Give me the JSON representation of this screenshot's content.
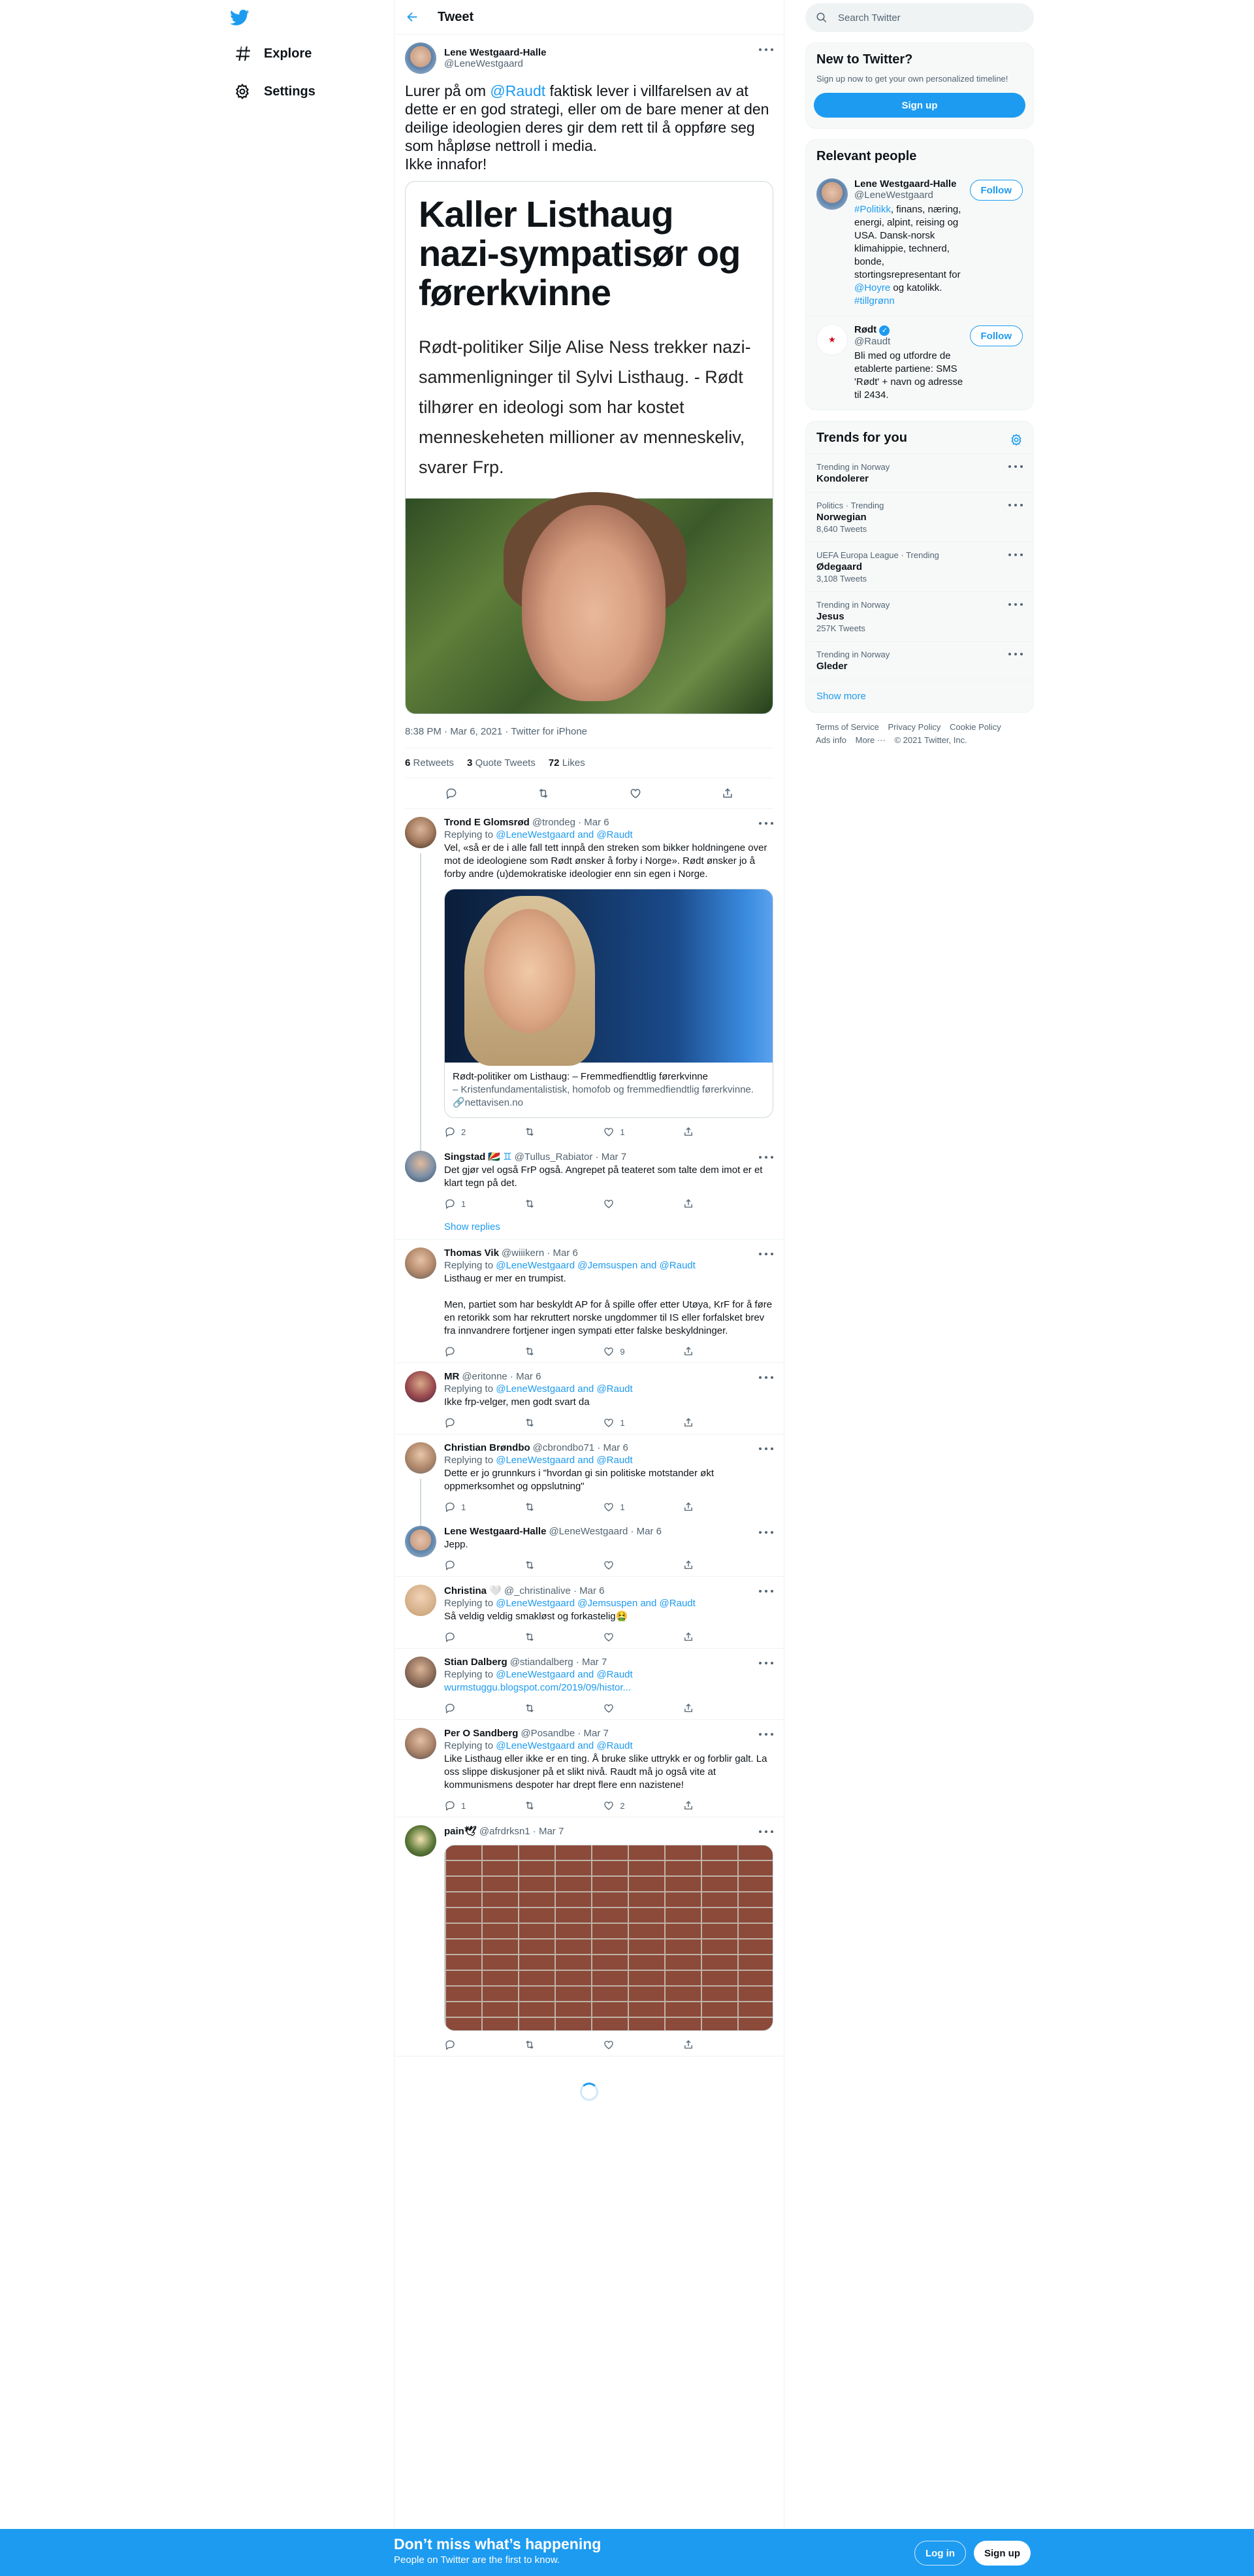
{
  "nav": {
    "explore_label": "Explore",
    "settings_label": "Settings"
  },
  "header": {
    "title": "Tweet"
  },
  "main_tweet": {
    "author_name": "Lene Westgaard-Halle",
    "author_handle": "@LeneWestgaard",
    "text_before": "Lurer på om ",
    "mention": "@Raudt",
    "text_after": " faktisk lever i villfarelsen av at dette er en god strategi, eller om de bare mener at den deilige ideologien deres gir dem rett til å oppføre seg som håpløse nettroll i media.\nIkke innafor!",
    "article_headline": "Kaller Listhaug nazi-sympatisør og førerkvinne",
    "article_lead": "Rødt-politiker Silje Alise Ness trekker nazi-sammenligninger til Sylvi Listhaug. - Rødt tilhører en ideologi som har kostet menneskeheten millioner av menneskeliv, svarer Frp.",
    "meta": "8:38 PM · Mar 6, 2021 · Twitter for iPhone",
    "retweets_count": "6",
    "retweets_label": "Retweets",
    "quotes_count": "3",
    "quotes_label": "Quote Tweets",
    "likes_count": "72",
    "likes_label": "Likes"
  },
  "replies": [
    {
      "name": "Trond E Glomsrød",
      "handle": "@trondeg · Mar 6",
      "replying_prefix": "Replying to ",
      "replying_to": "@LeneWestgaard and @Raudt",
      "text": "Vel, «så er de i alle fall tett innpå den streken som bikker holdningene over mot de ideologiene som Rødt ønsker å forby i Norge». Rødt ønsker jo å forby andre (u)demokratiske ideologier enn sin egen i Norge.",
      "card_title": "Rødt-politiker om Listhaug: – Fremmedfiendtlig førerkvinne",
      "card_sub": "– Kristenfundamentalistisk, homofob og fremmedfiendtlig førerkvinne.",
      "card_domain": "nettavisen.no",
      "replies": "2",
      "retweets": "",
      "likes": "1"
    },
    {
      "name": "Singstad",
      "handle": "@Tullus_Rabiator · Mar 7",
      "text": "Det gjør vel også FrP også. Angrepet på teateret som talte dem imot er et klart tegn på det.",
      "replies": "1",
      "retweets": "",
      "likes": ""
    },
    {
      "name": "Thomas Vik",
      "handle": "@wiiikern · Mar 6",
      "replying_prefix": "Replying to ",
      "replying_to": "@LeneWestgaard @Jemsuspen and @Raudt",
      "text": "Listhaug er mer en trumpist.\n\nMen, partiet som har beskyldt AP for å spille offer etter Utøya, KrF for å føre en retorikk som har rekruttert norske ungdommer til IS eller forfalsket brev fra innvandrere fortjener ingen sympati etter falske beskyldninger.",
      "replies": "",
      "retweets": "",
      "likes": "9"
    },
    {
      "name": "MR",
      "handle": "@eritonne · Mar 6",
      "replying_prefix": "Replying to ",
      "replying_to": "@LeneWestgaard and @Raudt",
      "text": "Ikke frp-velger, men godt svart da",
      "replies": "",
      "retweets": "",
      "likes": "1"
    },
    {
      "name": "Christian Brøndbo",
      "handle": "@cbrondbo71 · Mar 6",
      "replying_prefix": "Replying to ",
      "replying_to": "@LeneWestgaard and @Raudt",
      "text": "Dette er jo grunnkurs i \"hvordan gi sin politiske motstander økt oppmerksomhet og oppslutning\"",
      "replies": "1",
      "retweets": "",
      "likes": "1"
    },
    {
      "name": "Lene Westgaard-Halle",
      "handle": "@LeneWestgaard · Mar 6",
      "text": "Jepp.",
      "replies": "",
      "retweets": "",
      "likes": ""
    },
    {
      "name": "Christina 🤍",
      "handle": "@_christinalive · Mar 6",
      "replying_prefix": "Replying to ",
      "replying_to": "@LeneWestgaard @Jemsuspen and @Raudt",
      "text": "Så veldig veldig smakløst og forkastelig🤮",
      "replies": "",
      "retweets": "",
      "likes": ""
    },
    {
      "name": "Stian Dalberg",
      "handle": "@stiandalberg · Mar 7",
      "replying_prefix": "Replying to ",
      "replying_to": "@LeneWestgaard and @Raudt",
      "link": "wurmstuggu.blogspot.com/2019/09/histor...",
      "replies": "",
      "retweets": "",
      "likes": ""
    },
    {
      "name": "Per O Sandberg",
      "handle": "@Posandbe · Mar 7",
      "replying_prefix": "Replying to ",
      "replying_to": "@LeneWestgaard and @Raudt",
      "text": "Like Listhaug eller ikke er en ting. Å bruke slike uttrykk er og forblir galt. La oss slippe diskusjoner på et slikt nivå. Raudt må jo også vite at kommunismens despoter har drept flere enn nazistene!",
      "replies": "1",
      "retweets": "",
      "likes": "2"
    },
    {
      "name": "pain🕊",
      "handle": "@afrdrksn1 · Mar 7",
      "replies": "",
      "retweets": "",
      "likes": ""
    }
  ],
  "show_replies_label": "Show replies",
  "sidebar": {
    "search_placeholder": "Search Twitter",
    "new_title": "New to Twitter?",
    "new_sub": "Sign up now to get your own personalized timeline!",
    "signup_label": "Sign up",
    "relevant_title": "Relevant people",
    "people": [
      {
        "name": "Lene Westgaard-Halle",
        "handle": "@LeneWestgaard",
        "bio_tag": "#Politikk",
        "bio_mid": ", finans, næring, energi, alpint, reising og USA. Dansk-norsk klimahippie, technerd, bonde, stortingsrepresentant for ",
        "bio_mention": "@Hoyre",
        "bio_end": " og katolikk. ",
        "bio_tag2": "#tillgrønn",
        "follow": "Follow"
      },
      {
        "name": "Rødt",
        "handle": "@Raudt",
        "bio": "Bli med og utfordre de etablerte partiene: SMS 'Rødt' + navn og adresse til 2434.",
        "follow": "Follow"
      }
    ],
    "trends_title": "Trends for you",
    "trends": [
      {
        "ctx": "Trending in Norway",
        "name": "Kondolerer",
        "count": ""
      },
      {
        "ctx": "Politics · Trending",
        "name": "Norwegian",
        "count": "8,640 Tweets"
      },
      {
        "ctx": "UEFA Europa League · Trending",
        "name": "Ødegaard",
        "count": "3,108 Tweets"
      },
      {
        "ctx": "Trending in Norway",
        "name": "Jesus",
        "count": "257K Tweets"
      },
      {
        "ctx": "Trending in Norway",
        "name": "Gleder",
        "count": ""
      }
    ],
    "show_more": "Show more",
    "footer": {
      "terms": "Terms of Service",
      "privacy": "Privacy Policy",
      "cookie": "Cookie Policy",
      "ads": "Ads info",
      "more": "More ···",
      "copyright": "© 2021 Twitter, Inc."
    }
  },
  "banner": {
    "headline": "Don’t miss what’s happening",
    "sub": "People on Twitter are the first to know.",
    "login": "Log in",
    "signup": "Sign up"
  },
  "colors": {
    "accent": "#1d9bf0",
    "text": "#0f1419",
    "muted": "#536471"
  }
}
